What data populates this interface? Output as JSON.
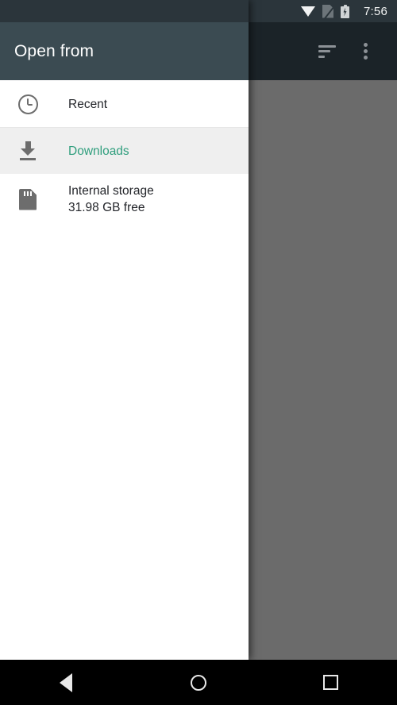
{
  "status_bar": {
    "time": "7:56",
    "icons": [
      "wifi-icon",
      "no-sim-icon",
      "battery-charging-icon"
    ],
    "background_color": "#2b353b"
  },
  "app_toolbar": {
    "background_color": "#1b2328",
    "actions": [
      {
        "name": "sort-icon",
        "label": "Sort"
      },
      {
        "name": "overflow-menu-icon",
        "label": "More options"
      }
    ]
  },
  "drawer": {
    "title": "Open from",
    "toolbar_color": "#3b4b52",
    "accent_color": "#2f9e7d",
    "selected_row_color": "#efefef",
    "items": [
      {
        "id": "recent",
        "label": "Recent",
        "sublabel": "",
        "icon": "clock-icon",
        "selected": false
      },
      {
        "id": "downloads",
        "label": "Downloads",
        "sublabel": "",
        "icon": "download-icon",
        "selected": true
      },
      {
        "id": "internal-storage",
        "label": "Internal storage",
        "sublabel": "31.98 GB free",
        "icon": "sd-card-icon",
        "selected": false
      }
    ]
  },
  "scrim": {
    "color": "#6b6b6b"
  },
  "nav_bar": {
    "background_color": "#000000",
    "buttons": [
      {
        "name": "nav-back-button",
        "label": "Back"
      },
      {
        "name": "nav-home-button",
        "label": "Home"
      },
      {
        "name": "nav-recents-button",
        "label": "Recents"
      }
    ]
  }
}
